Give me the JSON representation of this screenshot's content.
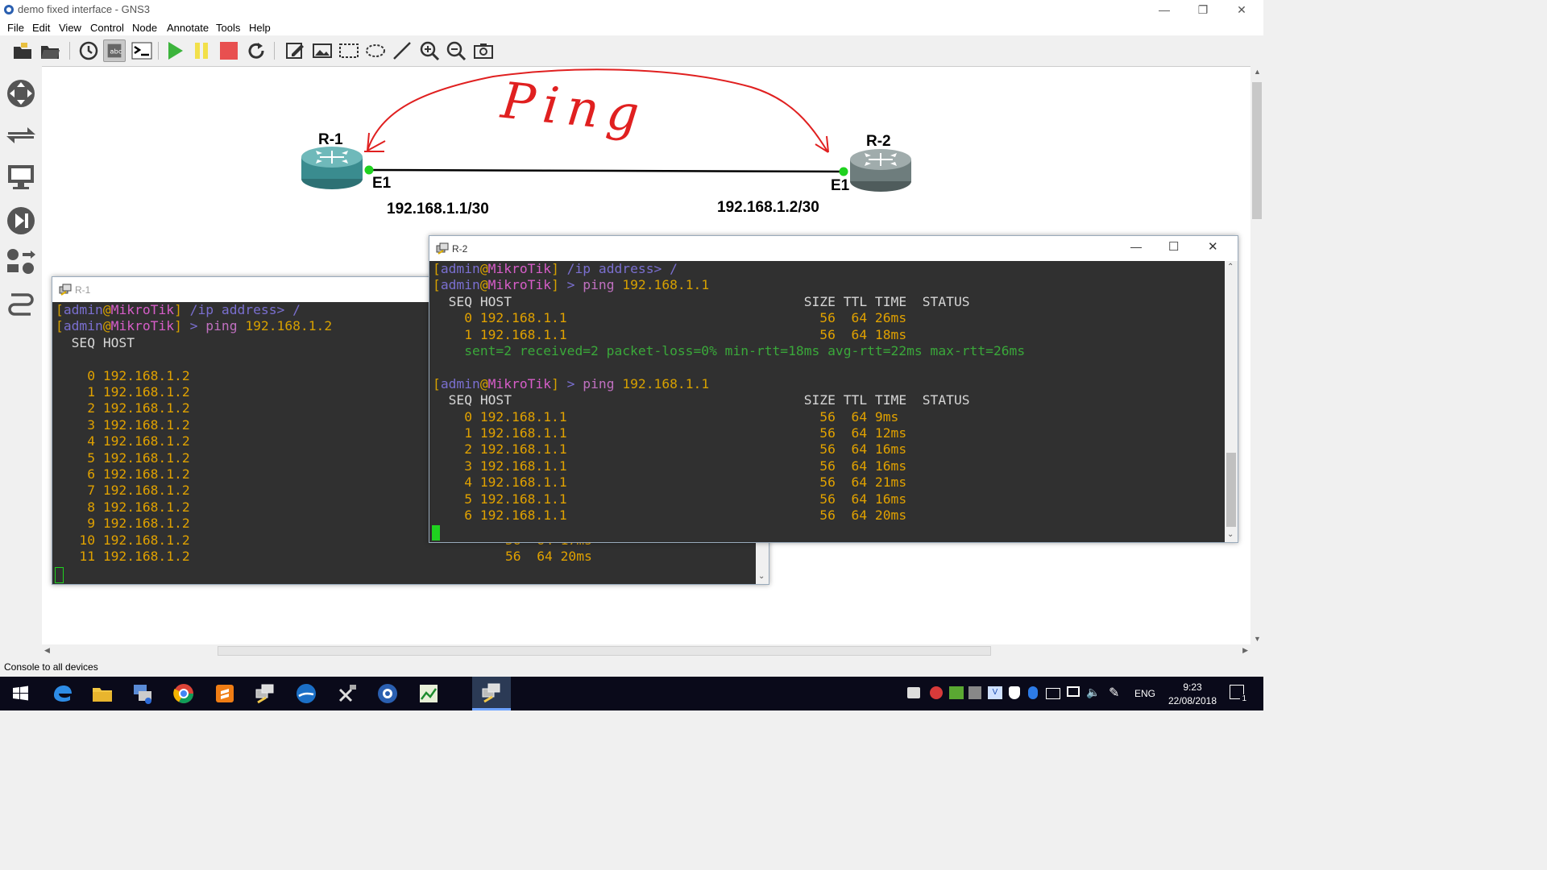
{
  "window": {
    "title": "demo fixed interface - GNS3"
  },
  "menu": [
    "File",
    "Edit",
    "View",
    "Control",
    "Node",
    "Annotate",
    "Tools",
    "Help"
  ],
  "toolbar": {
    "buttons": [
      "new-project-icon",
      "open-project-icon",
      "snapshot-icon",
      "show-interface-labels-icon",
      "console-all-icon",
      "start-icon",
      "suspend-icon",
      "stop-icon",
      "reload-icon",
      "add-note-icon",
      "insert-picture-icon",
      "draw-rectangle-icon",
      "draw-ellipse-icon",
      "draw-line-icon",
      "zoom-in-icon",
      "zoom-out-icon",
      "screenshot-icon"
    ]
  },
  "topology": {
    "nodes": [
      {
        "name": "R-1",
        "interface": "E1",
        "ip": "192.168.1.1/30"
      },
      {
        "name": "R-2",
        "interface": "E1",
        "ip": "192.168.1.2/30"
      }
    ],
    "annotation": "Ping",
    "colors": {
      "router_r1": "#3a8c8f",
      "router_r2": "#6e7d7d",
      "link_dot": "#1fd21f",
      "annotation": "#e02020"
    }
  },
  "console_r1": {
    "title": "R-1",
    "prompt": {
      "open": "[",
      "user": "admin",
      "at": "@",
      "host": "MikroTik",
      "close": "]"
    },
    "line1_cmd": " /ip address> /",
    "line2_cmd": " > ",
    "line2_ping": "ping",
    "line2_arg": " 192.168.1.2",
    "header": "  SEQ HOST",
    "rows": [
      "    0 192.168.1.2",
      "    1 192.168.1.2",
      "    2 192.168.1.2",
      "    3 192.168.1.2",
      "    4 192.168.1.2",
      "    5 192.168.1.2",
      "    6 192.168.1.2",
      "    7 192.168.1.2",
      "    8 192.168.1.2",
      "    9 192.168.1.2",
      "   10 192.168.1.2",
      "   11 192.168.1.2"
    ],
    "tail_row_10": "56  64 17ms",
    "tail_row_11": "56  64 20ms"
  },
  "console_r2": {
    "title": "R-2",
    "prompt": {
      "open": "[",
      "user": "admin",
      "at": "@",
      "host": "MikroTik",
      "close": "]"
    },
    "line1_cmd": " /ip address> /",
    "line2_cmd": " > ",
    "line2_ping": "ping",
    "line2_arg": " 192.168.1.1",
    "header": "  SEQ HOST                                     SIZE TTL TIME  STATUS",
    "block1": [
      "    0 192.168.1.1                                56  64 26ms",
      "    1 192.168.1.1                                56  64 18ms"
    ],
    "summary": "    sent=2 received=2 packet-loss=0% min-rtt=18ms avg-rtt=22ms max-rtt=26ms",
    "block2": [
      "    0 192.168.1.1                                56  64 9ms",
      "    1 192.168.1.1                                56  64 12ms",
      "    2 192.168.1.1                                56  64 16ms",
      "    3 192.168.1.1                                56  64 16ms",
      "    4 192.168.1.1                                56  64 21ms",
      "    5 192.168.1.1                                56  64 16ms",
      "    6 192.168.1.1                                56  64 20ms"
    ]
  },
  "statusbar": {
    "text": "Console to all devices"
  },
  "tray": {
    "lang": "ENG",
    "time": "9:23",
    "date": "22/08/2018",
    "notification_count": "1"
  }
}
